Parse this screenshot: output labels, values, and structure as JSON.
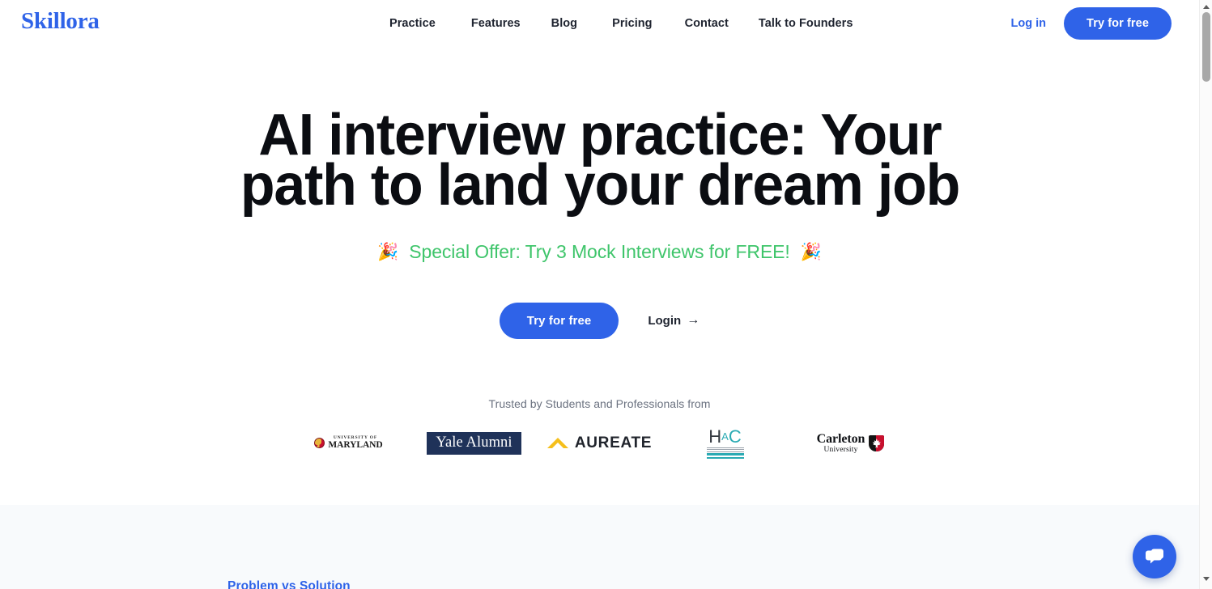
{
  "header": {
    "brand": "Skillora",
    "nav": [
      {
        "label": "Practice"
      },
      {
        "label": "Features"
      },
      {
        "label": "Blog"
      },
      {
        "label": "Pricing"
      },
      {
        "label": "Contact"
      },
      {
        "label": "Talk to Founders"
      }
    ],
    "login_label": "Log in",
    "cta_label": "Try for free"
  },
  "hero": {
    "title": "AI interview practice: Your path to land your dream job",
    "offer_text": "Special Offer: Try 3 Mock Interviews for FREE!",
    "offer_emoji_left": "🎉",
    "offer_emoji_right": "🎉",
    "primary_cta": "Try for free",
    "secondary_cta": "Login",
    "secondary_cta_arrow": "→"
  },
  "trusted": {
    "label": "Trusted by Students and Professionals from",
    "logos": [
      {
        "name": "university-of-maryland",
        "line1": "UNIVERSITY OF",
        "line2": "MARYLAND"
      },
      {
        "name": "yale-alumni",
        "text": "Yale Alumni"
      },
      {
        "name": "aureate",
        "text": "AUREATE"
      },
      {
        "name": "hac",
        "text": "HAC"
      },
      {
        "name": "carleton-university",
        "line1": "Carleton",
        "line2": "University"
      }
    ]
  },
  "next_section": {
    "eyebrow": "Problem vs Solution"
  },
  "chat": {
    "icon": "chat-bubble-icon"
  },
  "colors": {
    "brand_blue": "#2f63e8",
    "offer_green": "#3fc56b",
    "heading_black": "#0b0d12",
    "muted_gray": "#6b7280",
    "section_bg": "#f8fafc",
    "yale_navy": "#1f3259",
    "aureate_gold": "#f5bf1c",
    "hac_teal": "#2aaab3",
    "carleton_red": "#c8102e"
  }
}
